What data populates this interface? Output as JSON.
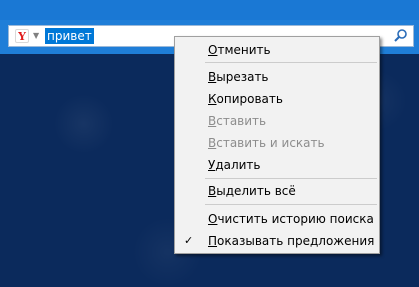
{
  "search": {
    "engine_logo": "Y",
    "engine_dropdown_icon": "chevron-down-icon",
    "query": "привет",
    "submit_icon": "search-icon"
  },
  "context_menu": {
    "items": [
      {
        "label": "Отменить",
        "enabled": true
      },
      {
        "label": "Вырезать",
        "enabled": true
      },
      {
        "label": "Копировать",
        "enabled": true
      },
      {
        "label": "Вставить",
        "enabled": false
      },
      {
        "label": "Вставить и искать",
        "enabled": false
      },
      {
        "label": "Удалить",
        "enabled": true
      },
      {
        "label": "Выделить всё",
        "enabled": true
      },
      {
        "label": "Очистить историю поиска",
        "enabled": true
      },
      {
        "label": "Показывать предложения",
        "enabled": true,
        "checked": true,
        "check_mark": "✓"
      }
    ]
  },
  "colors": {
    "selection": "#0078d7",
    "toolbar": "#1f7ed8",
    "background": "#0b2a5c",
    "menu_background": "#f2f2f2",
    "disabled_text": "#8d8d8d"
  }
}
